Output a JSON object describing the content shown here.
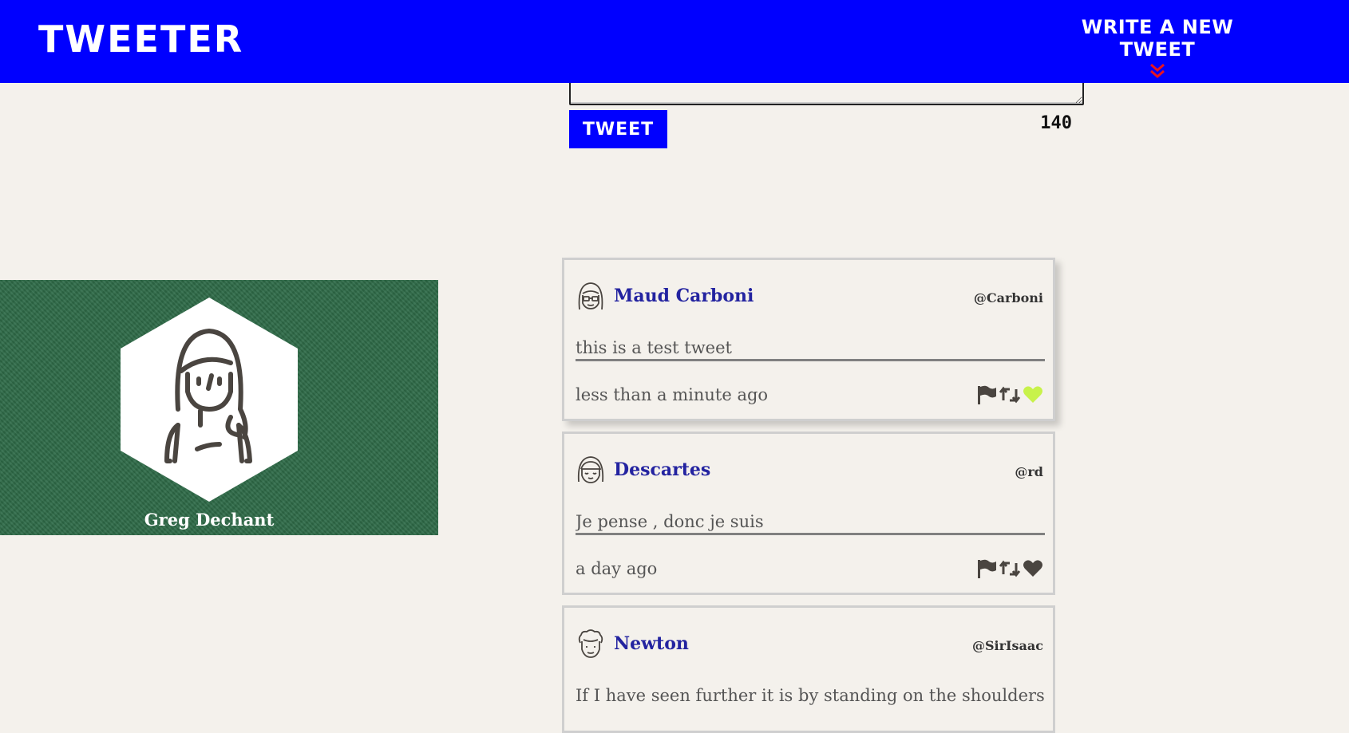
{
  "nav": {
    "brand": "Tweeter",
    "compose_label": "Write a new tweet"
  },
  "compose": {
    "button_label": "Tweet",
    "counter": "140"
  },
  "profile": {
    "name": "Greg Dechant"
  },
  "colors": {
    "accent": "#0000ff",
    "chevron": "#e8141e",
    "liked": "#c8f24a",
    "author": "#2323a0",
    "profile_bg": "#2e6b48"
  },
  "tweets": [
    {
      "author": "Maud Carboni",
      "handle": "@Carboni",
      "content": "this is a test tweet",
      "time": "less than a minute ago",
      "avatar_icon": "glasses-avatar-icon",
      "liked": true
    },
    {
      "author": "Descartes",
      "handle": "@rd",
      "content": "Je pense , donc je suis",
      "time": "a day ago",
      "avatar_icon": "bangs-avatar-icon",
      "liked": false
    },
    {
      "author": "Newton",
      "handle": "@SirIsaac",
      "content": "If I have seen further it is by standing on the shoulders of",
      "avatar_icon": "curly-hair-avatar-icon"
    }
  ]
}
